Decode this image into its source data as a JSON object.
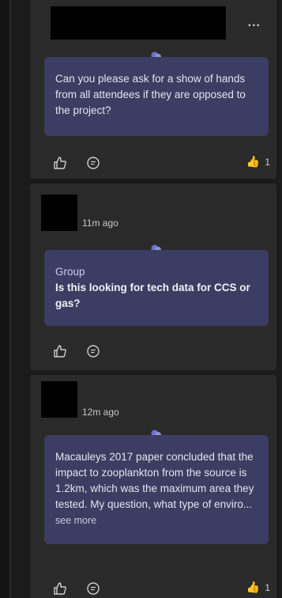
{
  "messages": [
    {
      "more_label": "...",
      "text": "Can you please ask for a show of hands from all attendees if they are opposed to the project?",
      "reaction_count": "1"
    },
    {
      "timestamp": "11m ago",
      "group": "Group",
      "text": "Is this looking for tech data for CCS or gas?"
    },
    {
      "timestamp": "12m ago",
      "text": "Macauleys 2017 paper concluded that the impact to zooplankton from the source is 1.2km, which was the maximum area they tested. My question, what type of enviro...",
      "see_more": "see more",
      "reaction_count": "1"
    }
  ],
  "icons": {
    "like": "like-outline-icon",
    "reply": "reply-bubble-icon",
    "thread": "speech-bubble-icon",
    "reaction": "thumbs-up-emoji"
  },
  "colors": {
    "bubble": "#3c3d62",
    "card": "#2a2a2a",
    "background": "#1b1b1b",
    "reaction": "#f2b33d"
  }
}
